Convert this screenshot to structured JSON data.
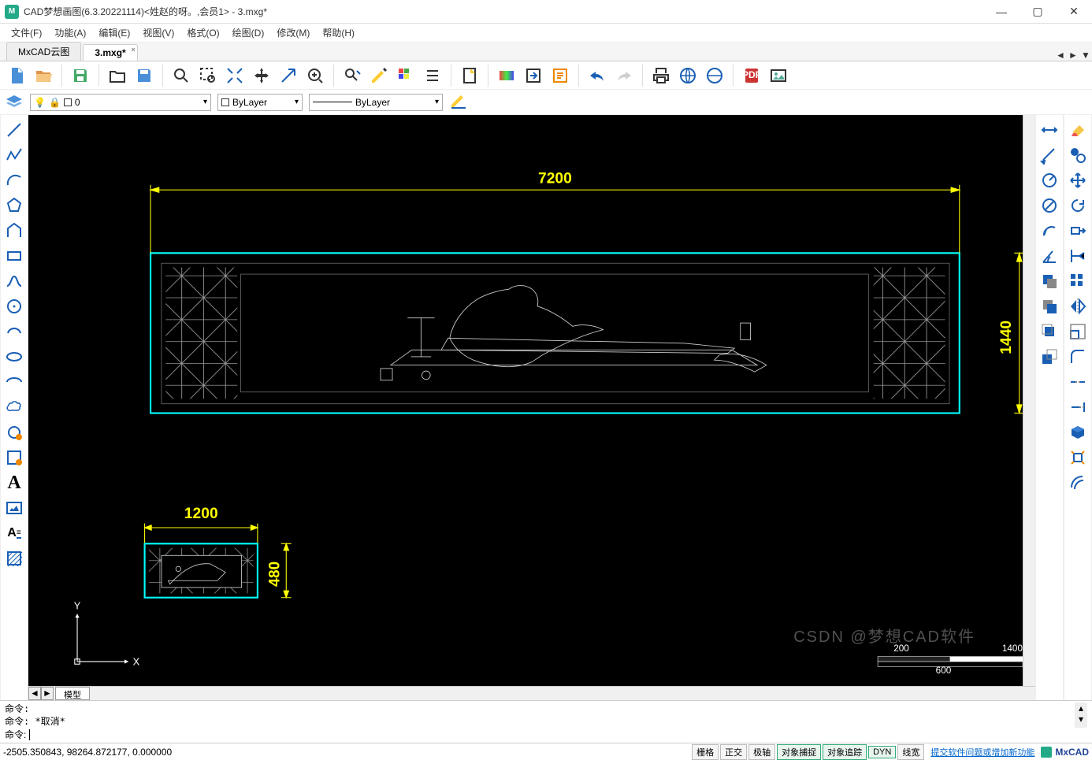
{
  "title": "CAD梦想画图(6.3.20221114)<姓赵的呀。,会员1> - 3.mxg*",
  "menus": [
    "文件(F)",
    "功能(A)",
    "编辑(E)",
    "视图(V)",
    "格式(O)",
    "绘图(D)",
    "修改(M)",
    "帮助(H)"
  ],
  "tabs": [
    {
      "label": "MxCAD云图",
      "active": false
    },
    {
      "label": "3.mxg*",
      "active": true
    }
  ],
  "layer_value": "0",
  "linetype_value": "ByLayer",
  "lineweight_value": "ByLayer",
  "sheet_tab": "模型",
  "cmd_history": [
    "命令:",
    "命令:  *取消*"
  ],
  "cmd_prompt": "命令:",
  "coords": "-2505.350843,  98264.872177,  0.000000",
  "status_toggles": [
    {
      "label": "栅格",
      "on": false
    },
    {
      "label": "正交",
      "on": false
    },
    {
      "label": "极轴",
      "on": false
    },
    {
      "label": "对象捕捉",
      "on": true
    },
    {
      "label": "对象追踪",
      "on": true
    },
    {
      "label": "DYN",
      "on": true
    },
    {
      "label": "线宽",
      "on": false
    }
  ],
  "feedback_link": "提交软件问题或增加新功能",
  "brand": "MxCAD",
  "watermark": "CSDN @梦想CAD软件",
  "dims": {
    "w1": "7200",
    "h1": "1440",
    "w2": "1200",
    "h2": "480"
  },
  "scale": {
    "l": "200",
    "r": "1400",
    "m": "600"
  },
  "axes": {
    "x": "X",
    "y": "Y"
  }
}
